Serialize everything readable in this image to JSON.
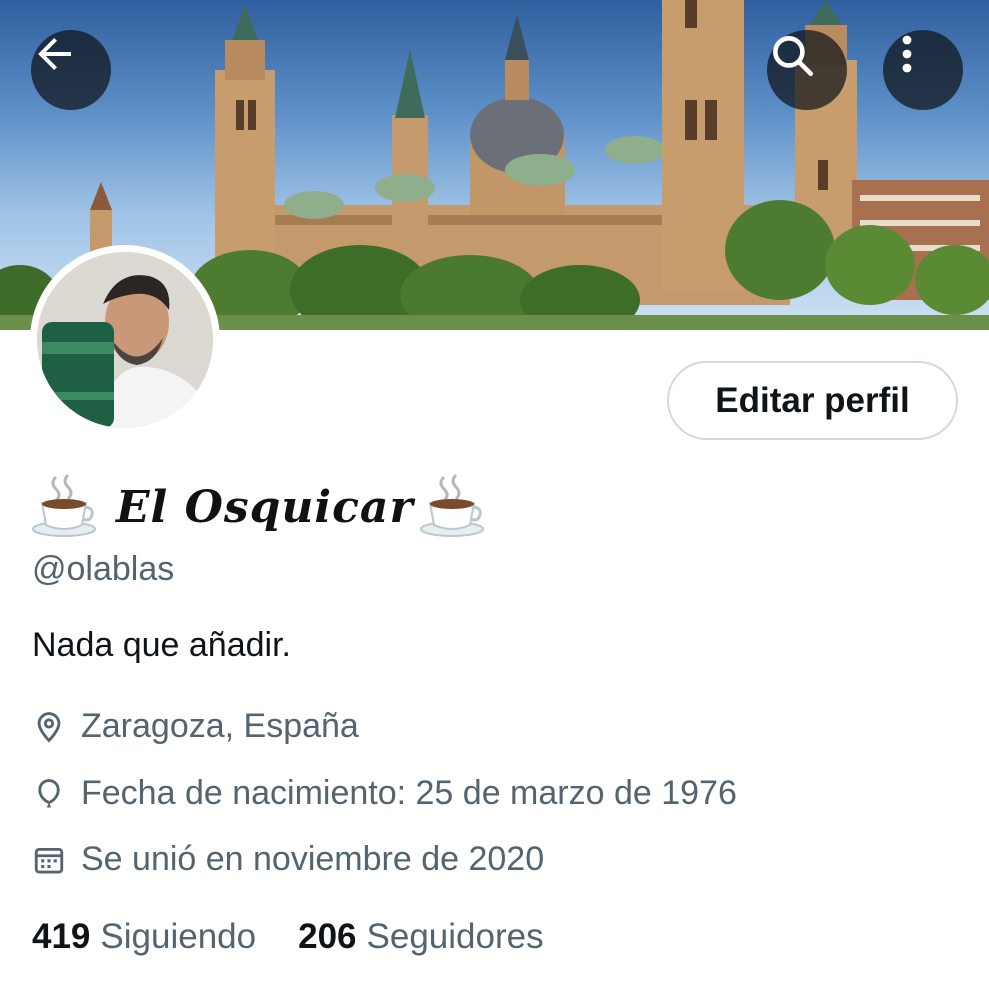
{
  "header": {
    "back_icon": "arrow-left-icon",
    "search_icon": "search-icon",
    "more_icon": "more-vertical-icon"
  },
  "profile": {
    "display_name": "El Osquicar",
    "name_emoji": "hot-beverage",
    "handle": "@olablas",
    "bio": "Nada que añadir.",
    "location": "Zaragoza, España",
    "birth_date": "Fecha de nacimiento: 25 de marzo de 1976",
    "joined": "Se unió en noviembre de 2020",
    "edit_button_label": "Editar perfil"
  },
  "stats": {
    "following_count": "419",
    "following_label": "Siguiendo",
    "followers_count": "206",
    "followers_label": "Seguidores"
  },
  "colors": {
    "text_primary": "#0f1419",
    "text_secondary": "#536471",
    "border": "#cfd9de",
    "overlay_button": "#0f1419"
  }
}
